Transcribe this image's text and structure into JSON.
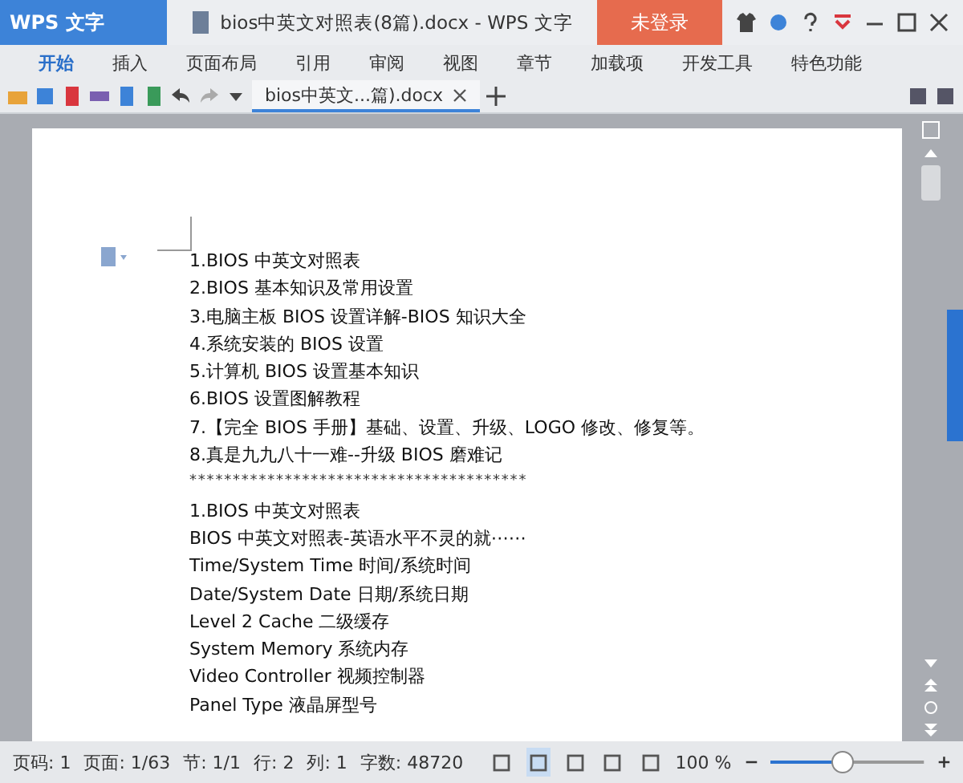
{
  "app_menu": {
    "label": "WPS 文字"
  },
  "window": {
    "title": "bios中英文对照表(8篇).docx - WPS 文字",
    "login": "未登录"
  },
  "ribbon_tabs": [
    {
      "label": "开始",
      "selected": true
    },
    {
      "label": "插入",
      "selected": false
    },
    {
      "label": "页面布局",
      "selected": false
    },
    {
      "label": "引用",
      "selected": false
    },
    {
      "label": "审阅",
      "selected": false
    },
    {
      "label": "视图",
      "selected": false
    },
    {
      "label": "章节",
      "selected": false
    },
    {
      "label": "加载项",
      "selected": false
    },
    {
      "label": "开发工具",
      "selected": false
    },
    {
      "label": "特色功能",
      "selected": false
    }
  ],
  "doc_tab": {
    "label": "bios中英文...篇).docx"
  },
  "document": {
    "lines": [
      "1.BIOS 中英文对照表",
      "2.BIOS 基本知识及常用设置",
      "3.电脑主板 BIOS 设置详解-BIOS 知识大全",
      "4.系统安装的 BIOS 设置",
      "5.计算机 BIOS 设置基本知识",
      "6.BIOS 设置图解教程",
      "7.【完全 BIOS 手册】基础、设置、升级、LOGO 修改、修复等。",
      "8.真是九九八十一难--升级 BIOS 磨难记",
      "***************************************",
      "1.BIOS 中英文对照表",
      "BIOS 中英文对照表-英语水平不灵的就⋯⋯",
      "Time/System Time  时间/系统时间",
      "Date/System Date  日期/系统日期",
      "Level 2 Cache  二级缓存",
      "System Memory  系统内存",
      "Video Controller  视频控制器",
      "Panel Type  液晶屏型号"
    ]
  },
  "status_bar": {
    "items": [
      "页码: 1",
      "页面: 1/63",
      "节: 1/1",
      "行: 2",
      "列: 1",
      "字数: 48720"
    ],
    "view_modes": [
      {
        "selected": false
      },
      {
        "selected": true
      },
      {
        "selected": false
      },
      {
        "selected": false
      },
      {
        "selected": false
      }
    ],
    "zoom": "100 %",
    "zoom_slider": {
      "level": 0.47
    }
  }
}
